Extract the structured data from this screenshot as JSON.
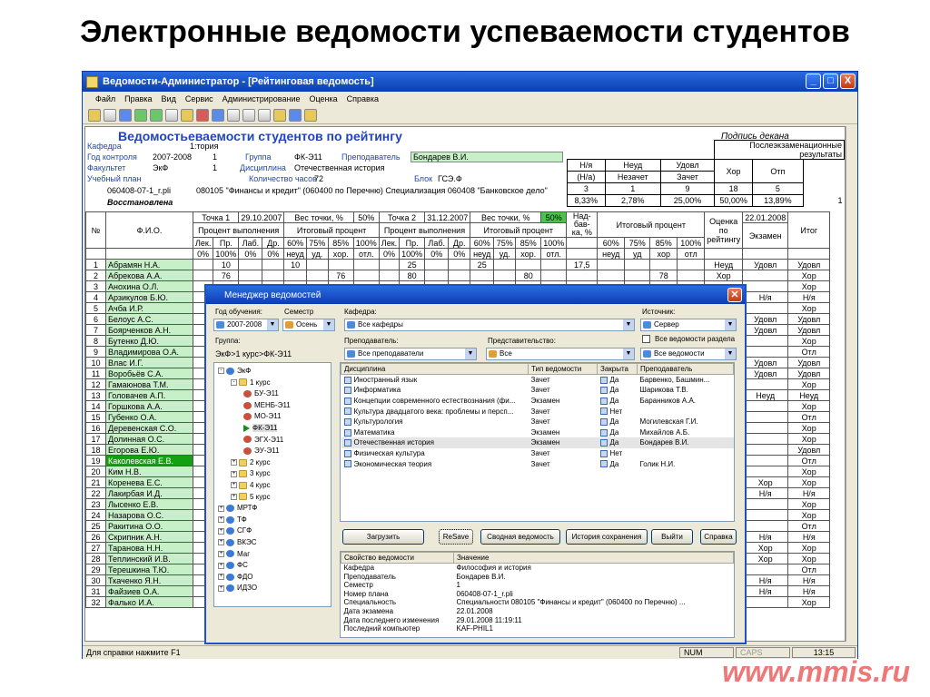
{
  "slide": {
    "title": "Электронные ведомости успеваемости студентов",
    "footer_url": "www.mmis.ru"
  },
  "window": {
    "title": "Ведомости-Администратор - [Рейтинговая ведомость]",
    "controls": {
      "minimize": "_",
      "maximize": "□",
      "close": "X"
    }
  },
  "menu": [
    "Файл",
    "Правка",
    "Вид",
    "Сервис",
    "Администрирование",
    "Оценка",
    "Справка"
  ],
  "document": {
    "title": "Ведомость",
    "title_rest": "еваемости студентов по рейтингу",
    "dean_sign": "Подпись декана",
    "labels": {
      "kafedra": "Кафедра",
      "god": "Год контроля",
      "fakultet": "Факультет",
      "plan": "Учебный план",
      "gruppa": "Группа",
      "disciplina": "Дисциплина",
      "kolvo": "Количество часов",
      "prepod": "Преподаватель",
      "blok": "Блок"
    },
    "values": {
      "kafedra": "1:тория",
      "god": "2007-2008",
      "god_n": "1",
      "fakultet": "ЭкФ",
      "fak_n": "1",
      "gruppa": "ФК-Э11",
      "disciplina": "Отечественная история",
      "kolvo": "72",
      "prepod": "Бондарев В.И.",
      "blok": "ГСЭ.Ф",
      "plan_file": "060408-07-1_r.pli",
      "plan_spec": "080105 \"Финансы и кредит\"  (060400 по Перечню)  Специализация 060408 \"Банковское дело\"",
      "restored": "Восстановлена"
    }
  },
  "results": {
    "header": "Послеэкзаменационные результаты",
    "cols": [
      "Н/я",
      "Неуд",
      "Удовл",
      "Хор",
      "Отп"
    ],
    "subcols": [
      "(Н/а)",
      "Незачет",
      "Зачет"
    ],
    "counts": [
      "3",
      "1",
      "9",
      "18",
      "5"
    ],
    "percents": [
      "8,33%",
      "2,78%",
      "25,00%",
      "50,00%",
      "13,89%"
    ],
    "tail": "1"
  },
  "grade_header": {
    "num": "№",
    "fio": "Ф.И.О.",
    "t1": "Точка 1",
    "t1_date": "29.10.2007",
    "w1": "Вес точки, %",
    "w1_v": "50%",
    "t2": "Точка 2",
    "t2_date": "31.12.2007",
    "w2": "Вес точки, %",
    "w2_v": "50%",
    "nadbavka": "Над-бав-ка, %",
    "itog_pct": "Итоговый процент",
    "ocenka": "Оценка по рейтингу",
    "exam_date": "22.01.2008",
    "exam": "Экзамен",
    "itog": "Итог",
    "proc_vyp": "Процент выполнения",
    "itog_proc": "Итоговый процент",
    "sub1": [
      "Лек.",
      "Пр.",
      "Лаб.",
      "Др."
    ],
    "sub2": [
      "60%",
      "75%",
      "85%",
      "100%"
    ],
    "pct1": [
      "0%",
      "100%",
      "0%",
      "0%"
    ],
    "pct2": [
      "неуд",
      "уд.",
      "хор.",
      "отл."
    ],
    "it_pct": [
      "60%",
      "75%",
      "85%",
      "100%"
    ],
    "it_lbl": [
      "неуд",
      "уд",
      "хор",
      "отл"
    ]
  },
  "students": [
    {
      "n": "1",
      "fio": "Абрамян Н.А.",
      "pr1": "10",
      "p60": "10",
      "pr2": "25",
      "q60": "25",
      "nad": "17,5",
      "oc": "Неуд",
      "ex": "Удовл",
      "it": "Удовл"
    },
    {
      "n": "2",
      "fio": "Абрекова А.А.",
      "pr1": "76",
      "p85": "76",
      "pr2": "80",
      "q85": "80",
      "i85": "78",
      "oc": "Хор",
      "ex": "",
      "it": "Хор"
    },
    {
      "n": "3",
      "fio": "Анохина О.Л.",
      "it": "Хор"
    },
    {
      "n": "4",
      "fio": "Арзикулов Б.Ю.",
      "ex": "Н/я",
      "it": "Н/я"
    },
    {
      "n": "5",
      "fio": "Ачба И.Р.",
      "it": "Хор"
    },
    {
      "n": "6",
      "fio": "Белоус А.С.",
      "ex": "Удовл",
      "it": "Удовл"
    },
    {
      "n": "7",
      "fio": "Боярченков А.Н.",
      "ex": "Удовл",
      "it": "Удовл"
    },
    {
      "n": "8",
      "fio": "Бутенко Д.Ю.",
      "it": "Хор"
    },
    {
      "n": "9",
      "fio": "Владимирова О.А.",
      "it": "Отл"
    },
    {
      "n": "10",
      "fio": "Влас И.Г.",
      "ex": "Удовл",
      "it": "Удовл"
    },
    {
      "n": "11",
      "fio": "Воробьёв С.А.",
      "ex": "Удовл",
      "it": "Удовл"
    },
    {
      "n": "12",
      "fio": "Гамаюнова Т.М.",
      "it": "Хор"
    },
    {
      "n": "13",
      "fio": "Головачев А.П.",
      "ex": "Неуд",
      "it": "Неуд"
    },
    {
      "n": "14",
      "fio": "Горшкова А.А.",
      "it": "Хор"
    },
    {
      "n": "15",
      "fio": "Губенко О.А.",
      "it": "Отл"
    },
    {
      "n": "16",
      "fio": "Деревенская С.О.",
      "it": "Хор"
    },
    {
      "n": "17",
      "fio": "Долинная О.С.",
      "it": "Хор"
    },
    {
      "n": "18",
      "fio": "Егорова Е.Ю.",
      "it": "Удовл"
    },
    {
      "n": "19",
      "fio": "Каколевская Е.В.",
      "it": "Отл",
      "sel": true
    },
    {
      "n": "20",
      "fio": "Ким Н.В.",
      "it": "Хор"
    },
    {
      "n": "21",
      "fio": "Коренева Е.С.",
      "ex": "Хор",
      "it": "Хор"
    },
    {
      "n": "22",
      "fio": "Лакирбая И.Д.",
      "ex": "Н/я",
      "it": "Н/я"
    },
    {
      "n": "23",
      "fio": "Лысенко Е.В.",
      "it": "Хор"
    },
    {
      "n": "24",
      "fio": "Назарова О.С.",
      "it": "Хор"
    },
    {
      "n": "25",
      "fio": "Ракитина О.О.",
      "it": "Отл"
    },
    {
      "n": "26",
      "fio": "Скрипник А.Н.",
      "ex": "Н/я",
      "it": "Н/я"
    },
    {
      "n": "27",
      "fio": "Таранова Н.Н.",
      "ex": "Хор",
      "it": "Хор"
    },
    {
      "n": "28",
      "fio": "Теплинский И.В.",
      "ex": "Хор",
      "it": "Хор"
    },
    {
      "n": "29",
      "fio": "Терешкина Т.Ю.",
      "it": "Отл"
    },
    {
      "n": "30",
      "fio": "Ткаченко Я.Н.",
      "ex": "Н/я",
      "it": "Н/я"
    },
    {
      "n": "31",
      "fio": "Файзиев О.А.",
      "ex": "Н/я",
      "it": "Н/я"
    },
    {
      "n": "32",
      "fio": "Фалько И.А.",
      "it": "Хор"
    }
  ],
  "statusbar": {
    "help": "Для справки нажмите F1",
    "num": "NUM",
    "caps": "CAPS",
    "time": "13:15"
  },
  "dialog": {
    "title": "Менеджер ведомостей",
    "labels": {
      "year": "Год обучения:",
      "sem": "Семестр",
      "kafedra": "Кафедра:",
      "source": "Источник:",
      "group": "Группа:",
      "prepod": "Преподаватель:",
      "predst": "Представительство:"
    },
    "values": {
      "year": "2007-2008",
      "sem": "Осень",
      "kafedra": "Все кафедры",
      "source": "Сервер",
      "all_kaf_chk": "Все ведомости раздела",
      "group_path": "ЭкФ>1 курс>ФК-Э11",
      "prepod": "Все преподаватели",
      "predst": "Все",
      "vedomosti": "Все ведомости"
    },
    "tree": [
      {
        "lvl": 0,
        "pm": "-",
        "icon": "globe",
        "label": "ЭкФ"
      },
      {
        "lvl": 1,
        "pm": "-",
        "icon": "folder",
        "label": "1 курс"
      },
      {
        "lvl": 2,
        "icon": "grp",
        "label": "БУ-Э11"
      },
      {
        "lvl": 2,
        "icon": "grp",
        "label": "МЕНБ-Э11"
      },
      {
        "lvl": 2,
        "icon": "grp",
        "label": "МО-Э11"
      },
      {
        "lvl": 2,
        "icon": "play",
        "label": "ФК-Э11"
      },
      {
        "lvl": 2,
        "icon": "grp",
        "label": "ЭГХ-Э11"
      },
      {
        "lvl": 2,
        "icon": "grp",
        "label": "ЭУ-Э11"
      },
      {
        "lvl": 1,
        "pm": "+",
        "icon": "folder",
        "label": "2 курс"
      },
      {
        "lvl": 1,
        "pm": "+",
        "icon": "folder",
        "label": "3 курс"
      },
      {
        "lvl": 1,
        "pm": "+",
        "icon": "folder",
        "label": "4 курс"
      },
      {
        "lvl": 1,
        "pm": "+",
        "icon": "folder",
        "label": "5 курс"
      },
      {
        "lvl": 0,
        "pm": "+",
        "icon": "globe",
        "label": "МРТФ"
      },
      {
        "lvl": 0,
        "pm": "+",
        "icon": "globe",
        "label": "ТФ"
      },
      {
        "lvl": 0,
        "pm": "+",
        "icon": "globe",
        "label": "СГФ"
      },
      {
        "lvl": 0,
        "pm": "+",
        "icon": "globe",
        "label": "ВКЭС"
      },
      {
        "lvl": 0,
        "pm": "+",
        "icon": "globe",
        "label": "Маг"
      },
      {
        "lvl": 0,
        "pm": "+",
        "icon": "globe",
        "label": "ФС"
      },
      {
        "lvl": 0,
        "pm": "+",
        "icon": "globe",
        "label": "ФДО"
      },
      {
        "lvl": 0,
        "pm": "+",
        "icon": "globe",
        "label": "ИДЗО"
      }
    ],
    "list_cols": [
      "Дисциплина",
      "Тип ведомости",
      "Закрыта",
      "Преподаватель"
    ],
    "list_rows": [
      [
        "Иностранный язык",
        "Зачет",
        "Да",
        "Барвенко, Башмин..."
      ],
      [
        "Информатика",
        "Зачет",
        "Да",
        "Шарикова Т.В."
      ],
      [
        "Концепции современного естествознания (фи...",
        "Экзамен",
        "Да",
        "Баранников А.А."
      ],
      [
        "Культура двадцатого века: проблемы и персп...",
        "Зачет",
        "Нет",
        ""
      ],
      [
        "Культурология",
        "Зачет",
        "Да",
        "Могилевская Г.И."
      ],
      [
        "Математика",
        "Экзамен",
        "Да",
        "Михайлов А.Б."
      ],
      [
        "Отечественная история",
        "Экзамен",
        "Да",
        "Бондарев В.И."
      ],
      [
        "Физическая культура",
        "Зачет",
        "Нет",
        ""
      ],
      [
        "Экономическая теория",
        "Зачет",
        "Да",
        "Голик Н.И."
      ]
    ],
    "buttons": [
      "Загрузить",
      "ReSave",
      "Сводная ведомость",
      "История сохранения",
      "Выйти",
      "Справка"
    ],
    "prop_cols": [
      "Свойство ведомости",
      "Значение"
    ],
    "props": [
      [
        "Кафедра",
        "Философия и история"
      ],
      [
        "Преподаватель",
        "Бондарев В.И."
      ],
      [
        "Семестр",
        "1"
      ],
      [
        "Номер плана",
        "060408-07-1_r.pli"
      ],
      [
        "Специальность",
        "Специальности  080105 \"Финансы и кредит\"  (060400 по Перечню) ..."
      ],
      [
        "Дата экзамена",
        "22.01.2008"
      ],
      [
        "Дата последнего изменения",
        "29.01.2008 11:19:11"
      ],
      [
        "Последний компьютер",
        "KAF-PHIL1"
      ]
    ]
  }
}
